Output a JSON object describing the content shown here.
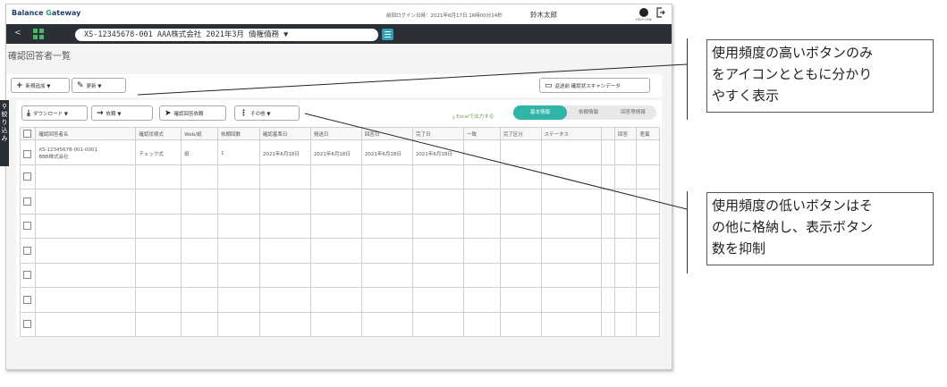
{
  "header": {
    "brand_b": "B",
    "brand_mid": "alance ",
    "brand_g": "G",
    "brand_end": "ateway",
    "last_login": "前回ログイン日時：2021年6月17日 16時00分24秒",
    "user_name": "鈴木太郎",
    "help_label": "HELP LINK"
  },
  "nav": {
    "back": "<",
    "context": "XS-12345678-001 AAA株式会社 2021年3月 債権債務 ▼"
  },
  "page": {
    "title": "確認回答者一覧"
  },
  "toolbar1": {
    "new_add": "新規追加 ▼",
    "update": "更新 ▼",
    "scan": "返送前 確認状スキャンデータ"
  },
  "side_tab": {
    "label1": "絞",
    "label2": "り",
    "label3": "込",
    "label4": "み"
  },
  "toolbar2": {
    "download": "ダウンロード ▼",
    "request": "依頼 ▼",
    "confirm_request": "確認回答依頼",
    "other": "その他 ▼",
    "excel": "Excelで出力する"
  },
  "tabs": [
    "基本情報",
    "依頼情報",
    "回答等情報"
  ],
  "table": {
    "headers": [
      "",
      "確認回答者名",
      "確認状様式",
      "Web/紙",
      "依頼回数",
      "確認基準日",
      "発送日",
      "回答日",
      "完了日",
      "一致",
      "完了区分",
      "ステータス",
      "",
      "回答",
      "差異"
    ],
    "row1": {
      "name1": "XS-12345678-001-0001",
      "name2": "BBB株式会社",
      "form": "チェック式",
      "medium": "紙",
      "count": "1",
      "base_date": "2021年6月18日",
      "send_date": "2021年6月18日",
      "reply_date": "2021年6月18日",
      "done_date": "2021年6月18日"
    }
  },
  "callouts": {
    "top": [
      "使用頻度の高いボタンのみ",
      "をアイコンとともに分かり",
      "やすく表示"
    ],
    "bottom": [
      "使用頻度の低いボタンはそ",
      "の他に格納し、表示ボタン",
      "数を抑制"
    ]
  }
}
